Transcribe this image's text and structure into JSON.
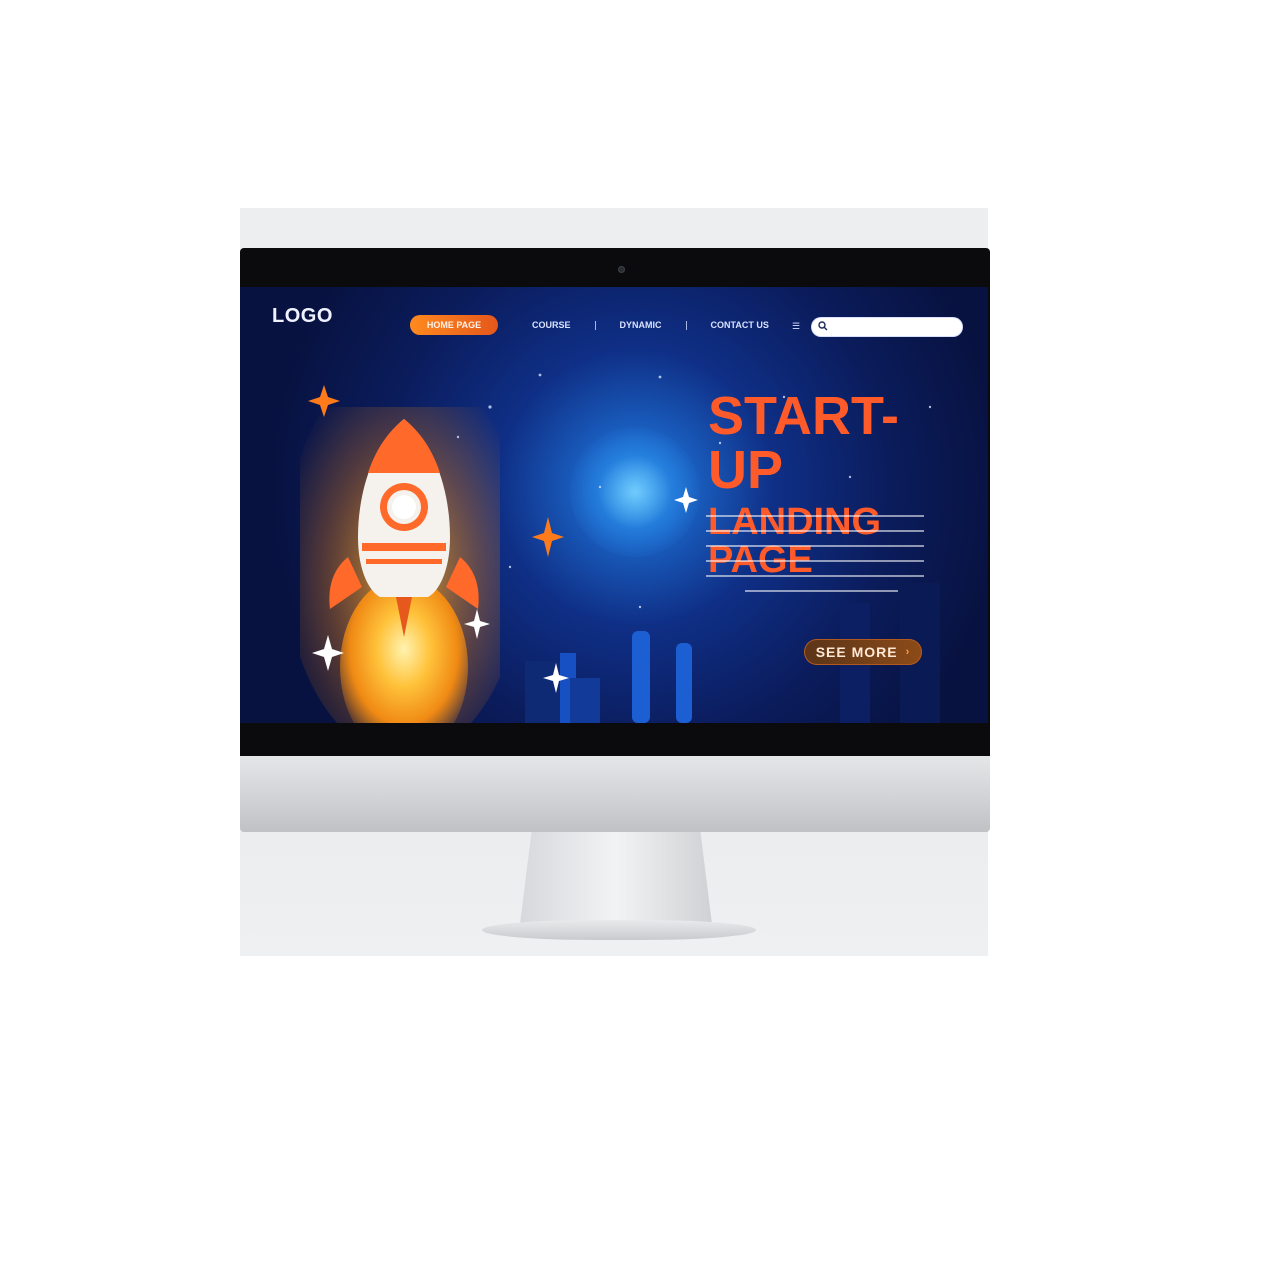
{
  "screen": {
    "logo_text": "LOGO",
    "nav": {
      "home_label": "HOME PAGE",
      "items": [
        "COURSE",
        "DYNAMIC",
        "CONTACT US"
      ]
    },
    "search": {
      "placeholder": ""
    },
    "hero": {
      "title_line1": "START-UP",
      "title_line2": "LANDING PAGE"
    },
    "cta": {
      "label": "SEE MORE",
      "arrow": "›"
    }
  },
  "colors": {
    "accent_orange": "#ff5a2a",
    "home_button": "#ff8a1f",
    "screen_bg": "#0b1c5c",
    "see_more_bg": "#6b3a17"
  },
  "icons": {
    "menu": "hamburger-icon",
    "search": "search-icon",
    "rocket": "rocket-icon"
  }
}
